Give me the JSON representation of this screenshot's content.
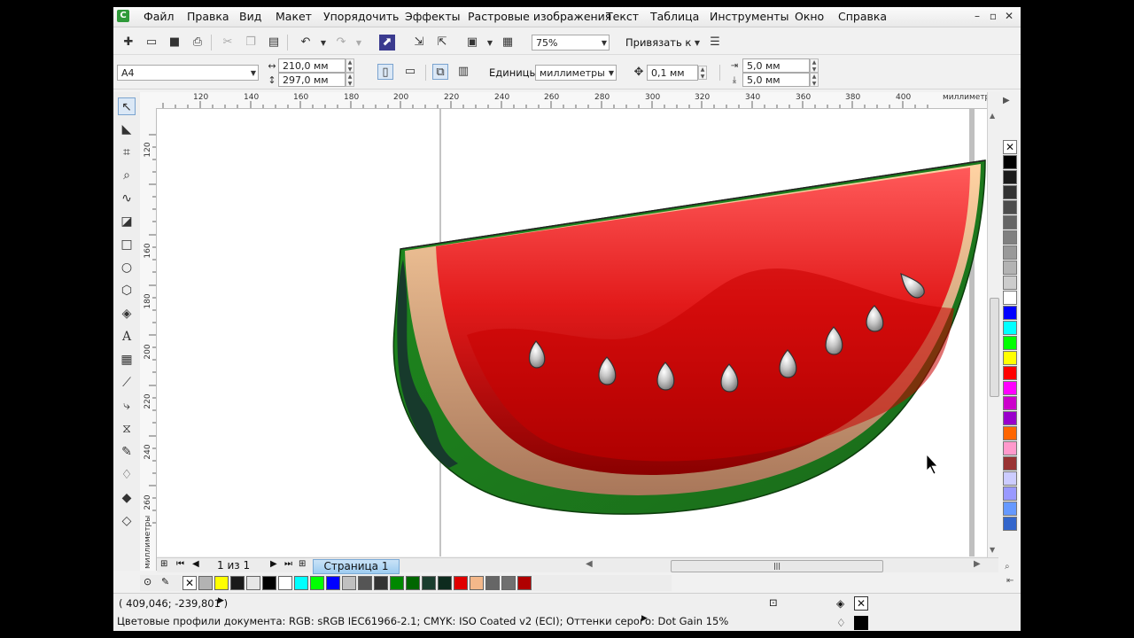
{
  "menu": [
    "Файл",
    "Правка",
    "Вид",
    "Макет",
    "Упорядочить",
    "Эффекты",
    "Растровые изображения",
    "Текст",
    "Таблица",
    "Инструменты",
    "Окно",
    "Справка"
  ],
  "window_buttons": [
    "–",
    "▫",
    "✕"
  ],
  "toolbar": {
    "zoom": "75%",
    "snap_label": "Привязать к"
  },
  "property_bar": {
    "page_size": "A4",
    "width": "210,0 мм",
    "height": "297,0 мм",
    "units_label": "Единицы:",
    "units_value": "миллиметры",
    "nudge": "0,1 мм",
    "dup_x": "5,0 мм",
    "dup_y": "5,0 мм"
  },
  "rulers": {
    "horizontal_ticks": [
      "120",
      "140",
      "160",
      "180",
      "200",
      "220",
      "240",
      "260",
      "280",
      "300",
      "320",
      "340",
      "360",
      "380",
      "400"
    ],
    "horizontal_unit": "миллиметры",
    "vertical_ticks": [
      "120",
      "160",
      "180",
      "200",
      "220",
      "240",
      "260"
    ],
    "vertical_unit": "миллиметры"
  },
  "page_nav": {
    "counter": "1 из 1",
    "tab": "Страница 1"
  },
  "status": {
    "coords": "( 409,046; -239,801 )",
    "profiles": "Цветовые профили документа: RGB: sRGB IEC61966-2.1; CMYK: ISO Coated v2 (ECI); Оттенки серого: Dot Gain 15%"
  },
  "colors": {
    "palette_column": [
      "none",
      "#000000",
      "#1a1a1a",
      "#333333",
      "#4d4d4d",
      "#666666",
      "#808080",
      "#999999",
      "#b3b3b3",
      "#cccccc",
      "#ffffff",
      "#0000ff",
      "#00ffff",
      "#00ff00",
      "#ffff00",
      "#ff0000",
      "#ff00ff",
      "#cc00cc",
      "#9900cc",
      "#ff6600",
      "#ff99cc",
      "#993333",
      "#ccccff",
      "#9999ff",
      "#6699ff",
      "#3366cc"
    ],
    "document_palette": [
      "none",
      "#b3b3b3",
      "#ffff00",
      "#1a1a1a",
      "#e6e6e6",
      "#000000",
      "#ffffff",
      "#00ffff",
      "#00ff00",
      "#0000ff",
      "#c0c0c0",
      "#555555",
      "#333333",
      "#008800",
      "#006600",
      "#1a3d2e",
      "#0d2b1e",
      "#e00000",
      "#f4b88a",
      "#666666",
      "#707070",
      "#b00000"
    ]
  }
}
